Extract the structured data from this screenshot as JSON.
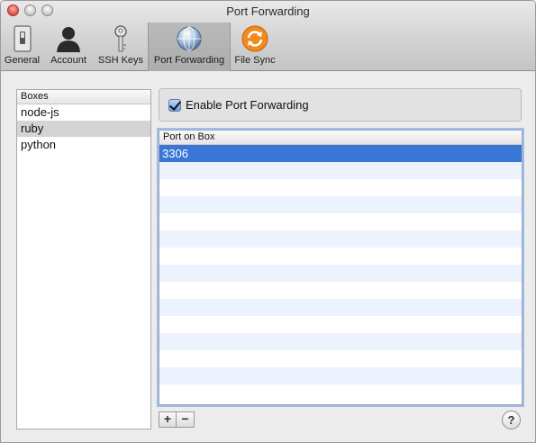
{
  "window": {
    "title": "Port Forwarding"
  },
  "toolbar": {
    "items": [
      {
        "label": "General",
        "icon": "switch-icon"
      },
      {
        "label": "Account",
        "icon": "user-icon"
      },
      {
        "label": "SSH Keys",
        "icon": "key-icon"
      },
      {
        "label": "Port Forwarding",
        "icon": "globe-icon",
        "selected": true
      },
      {
        "label": "File Sync",
        "icon": "sync-icon"
      }
    ]
  },
  "boxes": {
    "header": "Boxes",
    "items": [
      "node-js",
      "ruby",
      "python"
    ],
    "selected": "ruby"
  },
  "port_forwarding": {
    "enable_label": "Enable Port Forwarding",
    "enabled": true,
    "table_header": "Port on Box",
    "rows": [
      "3306"
    ]
  },
  "controls": {
    "add": "+",
    "remove": "−",
    "help": "?"
  },
  "colors": {
    "selection": "#3a76d6",
    "sync_icon": "#f28a1e"
  }
}
